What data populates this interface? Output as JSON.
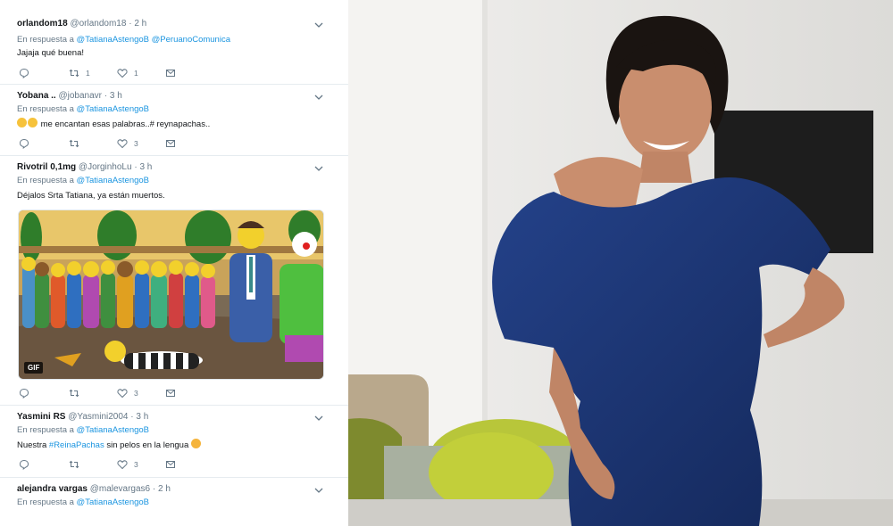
{
  "tweets": [
    {
      "name": "orlandom18",
      "handle": "@orlandom18",
      "time": "· 2 h",
      "reply_prefix": "En respuesta a",
      "mentions": "@TatianaAstengoB @PeruanoComunica",
      "text": "Jajaja qué buena!",
      "retweets": "1",
      "likes": "1"
    },
    {
      "name": "Yobana ..",
      "handle": "@jobanavr",
      "time": "· 3 h",
      "reply_prefix": "En respuesta a",
      "mentions": "@TatianaAstengoB",
      "text": "me encantan esas palabras..# reynapachas..",
      "retweets": "",
      "likes": "3"
    },
    {
      "name": "Rivotril 0,1mg",
      "handle": "@JorginhoLu",
      "time": "· 3 h",
      "reply_prefix": "En respuesta a",
      "mentions": "@TatianaAstengoB",
      "text": "Déjalos Srta Tatiana, ya están muertos.",
      "media_badge": "GIF",
      "retweets": "",
      "likes": "3"
    },
    {
      "name": "Yasmini RS",
      "handle": "@Yasmini2004",
      "time": "· 3 h",
      "reply_prefix": "En respuesta a",
      "mentions": "@TatianaAstengoB",
      "text_prefix": "Nuestra",
      "hashtag": "#ReinaPachas",
      "text_suffix": "sin pelos en la lengua",
      "retweets": "",
      "likes": "3"
    },
    {
      "name": "alejandra vargas",
      "handle": "@malevargas6",
      "time": "· 2 h",
      "reply_prefix": "En respuesta a",
      "mentions": "@TatianaAstengoB"
    }
  ],
  "icons": {
    "reply": "reply-icon",
    "retweet": "retweet-icon",
    "like": "heart-icon",
    "dm": "envelope-icon",
    "menu": "chevron-down-icon"
  },
  "colors": {
    "link": "#1b95e0",
    "muted": "#657786",
    "dress": "#1e3a7a",
    "wall": "#ecebe8"
  }
}
